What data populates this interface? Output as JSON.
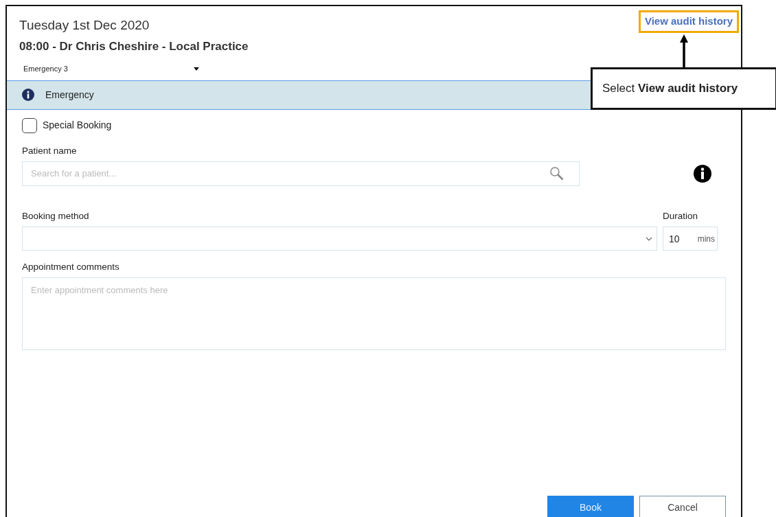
{
  "header": {
    "date": "Tuesday 1st Dec 2020",
    "slot": "08:00 - Dr Chris Cheshire - Local Practice",
    "audit_link": "View audit history"
  },
  "slot_type": {
    "value": "Emergency 3"
  },
  "info_banner": {
    "text": "Emergency"
  },
  "special_booking": {
    "label": "Special Booking",
    "checked": false
  },
  "patient": {
    "label": "Patient name",
    "placeholder": "Search for a patient..."
  },
  "booking_method": {
    "label": "Booking method"
  },
  "duration": {
    "label": "Duration",
    "value": "10",
    "unit": "mins"
  },
  "comments": {
    "label": "Appointment comments",
    "placeholder": "Enter appointment comments here"
  },
  "buttons": [
    {
      "label": "Book",
      "kind": "primary"
    },
    {
      "label": "Cancel",
      "kind": "secondary"
    }
  ],
  "callout": {
    "text": "Select **View audit history**"
  }
}
